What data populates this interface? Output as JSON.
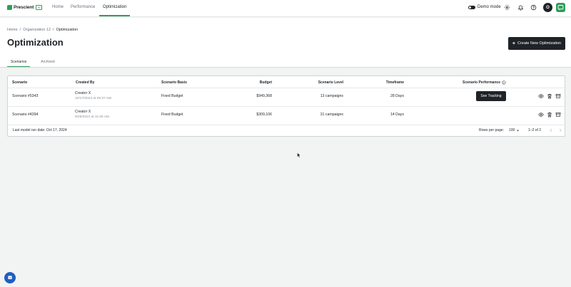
{
  "app": {
    "logo_text": "Prescient",
    "logo_badge": "AI"
  },
  "nav": {
    "items": [
      {
        "label": "Home"
      },
      {
        "label": "Performance"
      },
      {
        "label": "Optimization"
      }
    ]
  },
  "header_right": {
    "demo_label": "Demo mode",
    "avatar_initial": "O"
  },
  "breadcrumb": {
    "items": [
      "Home",
      "Organization 12",
      "Optimization"
    ]
  },
  "page": {
    "title": "Optimization",
    "create_label": "Create New Optimization"
  },
  "tabs": [
    {
      "label": "Scenarios"
    },
    {
      "label": "Archived"
    }
  ],
  "table": {
    "headers": [
      "Scenario",
      "Created By",
      "Scenario Basis",
      "Budget",
      "Scenario Level",
      "Timeframe",
      "Scenario Performance"
    ],
    "rows": [
      {
        "scenario": "Scenario #5343",
        "creator": "Creator X",
        "created_at": "10/17/2024 at 09:37 AM",
        "basis": "Fixed Budget",
        "budget": "$949,368",
        "level": "13 campaigns",
        "timeframe": "28 Days",
        "performance_action": "See Tracking"
      },
      {
        "scenario": "Scenario #4394",
        "creator": "Creator X",
        "created_at": "8/29/2024 at 11:00 AM",
        "basis": "Fixed Budget",
        "budget": "$309,106",
        "level": "31 campaigns",
        "timeframe": "14 Days",
        "performance_action": ""
      }
    ],
    "footer": {
      "last_run": "Last model run date: Oct 17, 2024",
      "rows_per_page_label": "Rows per page:",
      "rows_per_page_value": "100",
      "range": "1–2 of 2"
    }
  },
  "colors": {
    "accent": "#2f9e5a",
    "dark": "#1f2328",
    "chat": "#1f5fbf"
  },
  "icons": [
    "gear-icon",
    "bell-icon",
    "help-icon",
    "eye-icon",
    "trash-icon",
    "archive-icon",
    "info-icon",
    "plus-icon",
    "chevron-left-icon",
    "chevron-right-icon",
    "chat-icon"
  ]
}
